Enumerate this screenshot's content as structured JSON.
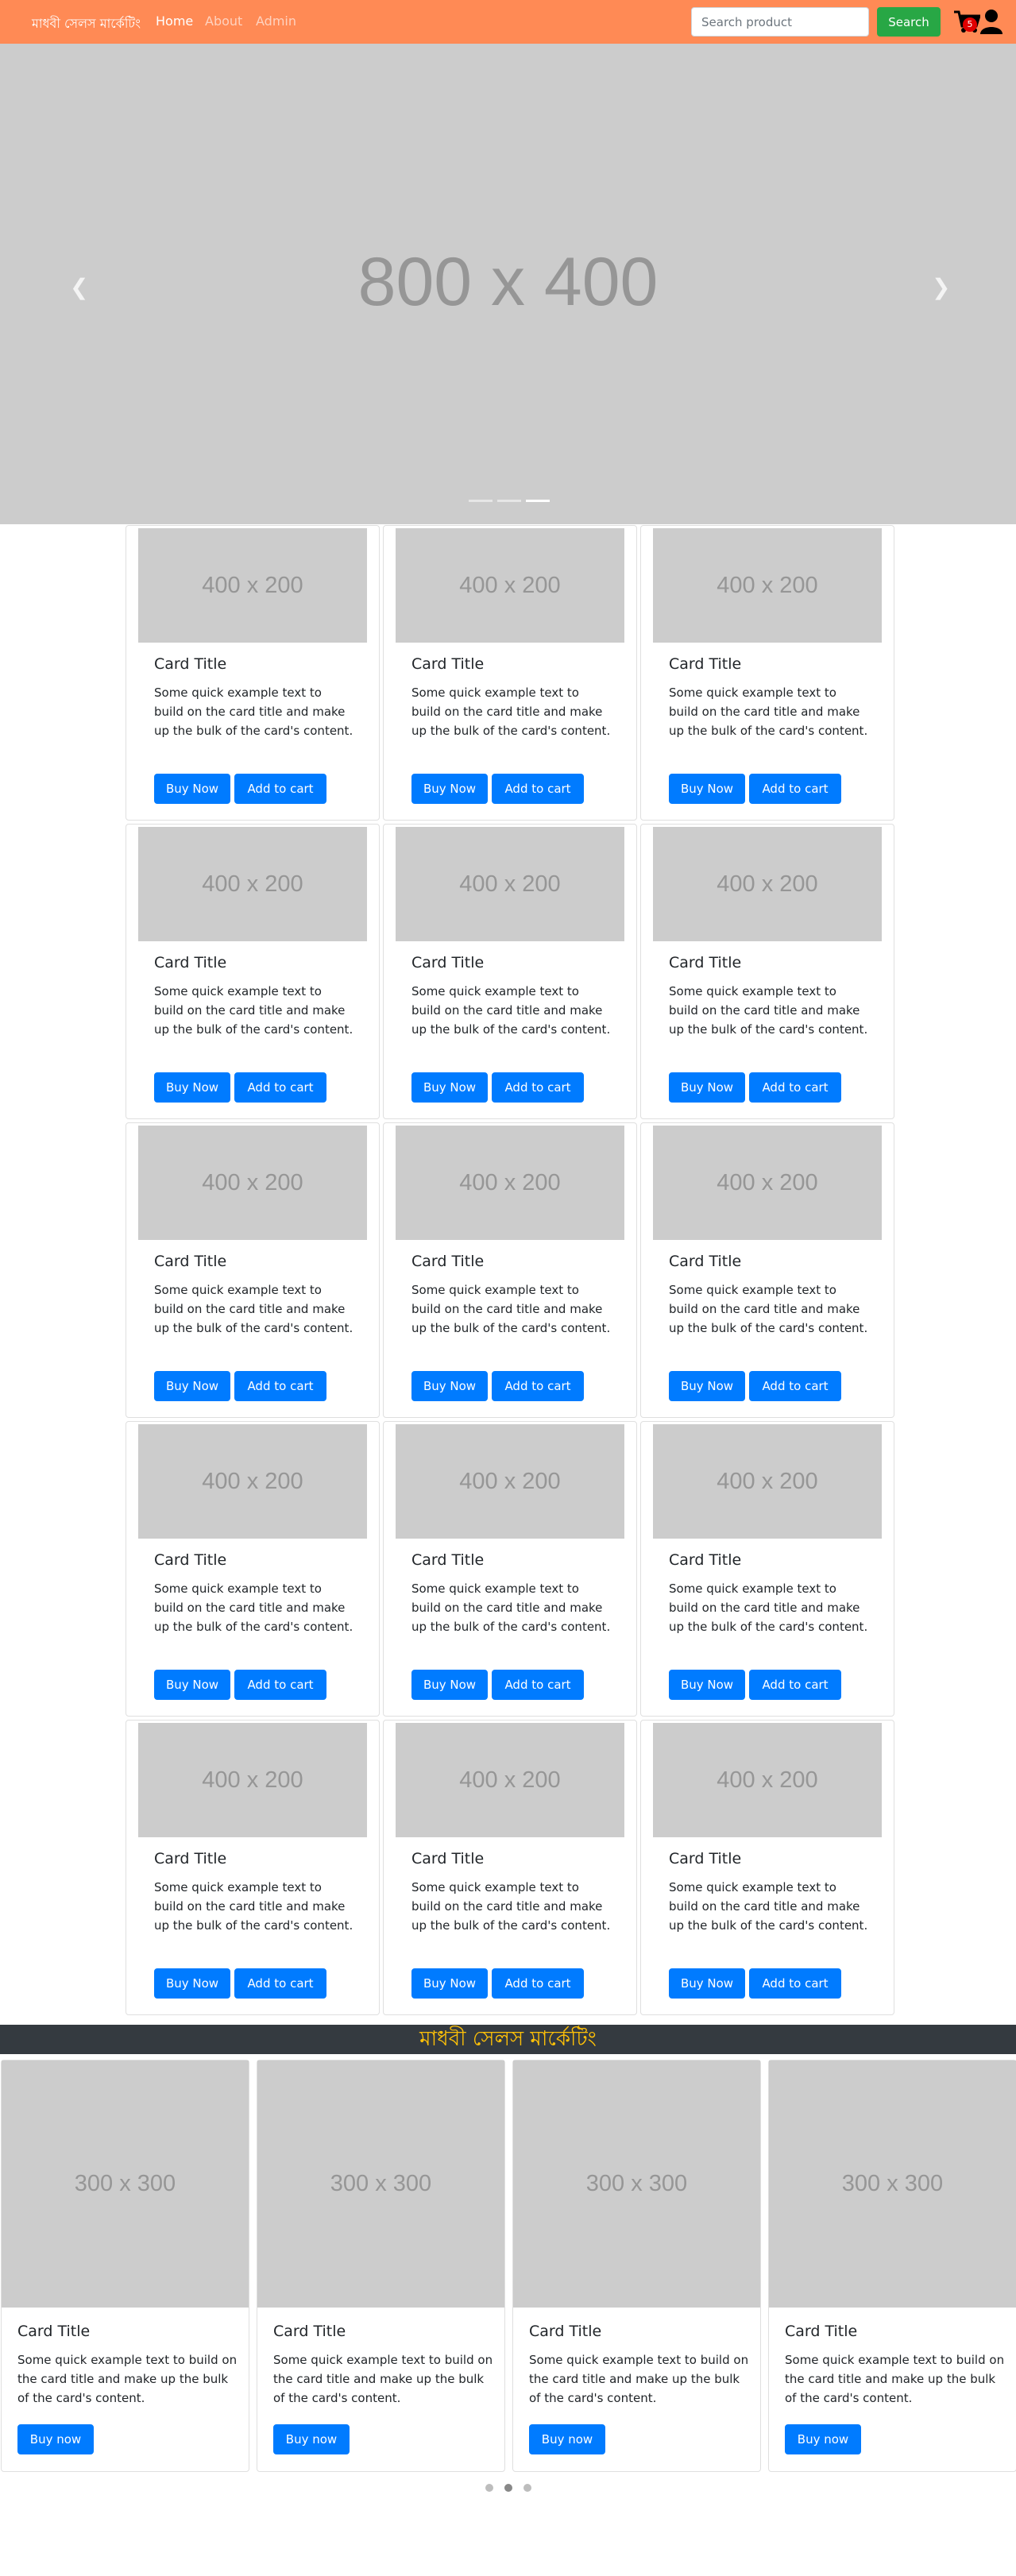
{
  "navbar": {
    "brand": "মাধবী সেলস মার্কেটিং",
    "links": [
      "Home",
      "About",
      "Admin"
    ],
    "search_placeholder": "Search product",
    "search_button": "Search",
    "cart_count": "5",
    "bg_color": "#ff8a55"
  },
  "hero": {
    "image_text": "800 x 400",
    "prev_icon": "chevron-left-icon",
    "next_icon": "chevron-right-icon",
    "slide_count": 3,
    "active_slide": 3
  },
  "products": {
    "image_text": "400 x 200",
    "title": "Card Title",
    "text": "Some quick example text to build on the card title and make up the bulk of the card's content.",
    "buy_label": "Buy Now",
    "cart_label": "Add to cart",
    "rows": 5,
    "columns": 3
  },
  "banner": {
    "text": "মাধবী সেলস মার্কেটিং",
    "bg_color": "#343a40",
    "text_color": "#ffc107"
  },
  "featured": {
    "image_text": "300 x 300",
    "title": "Card Title",
    "text": "Some quick example text to build on the card title and make up the bulk of the card's content.",
    "buy_label": "Buy now",
    "count": 4,
    "page_count": 3,
    "active_page": 2
  },
  "colors": {
    "primary": "#007bff",
    "success": "#28a745",
    "placeholder_bg": "#cccccc",
    "badge": "#e00000"
  }
}
